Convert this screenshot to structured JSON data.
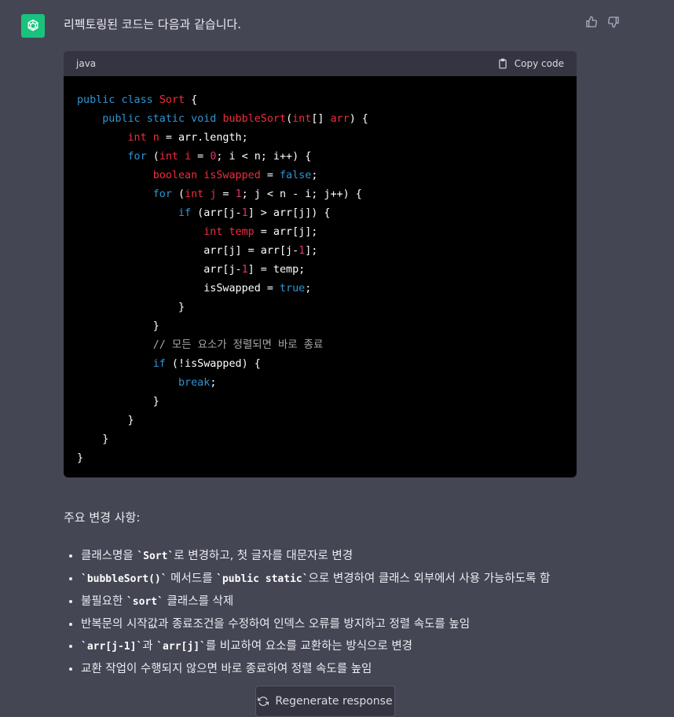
{
  "message": {
    "intro": "리펙토링된 코드는 다음과 같습니다.",
    "avatar_icon": "openai-logo-icon"
  },
  "codeblock": {
    "language": "java",
    "copy_label": "Copy code",
    "lines": [
      "public class Sort {",
      "    public static void bubbleSort(int[] arr) {",
      "        int n = arr.length;",
      "        for (int i = 0; i < n; i++) {",
      "            boolean isSwapped = false;",
      "            for (int j = 1; j < n - i; j++) {",
      "                if (arr[j-1] > arr[j]) {",
      "                    int temp = arr[j];",
      "                    arr[j] = arr[j-1];",
      "                    arr[j-1] = temp;",
      "                    isSwapped = true;",
      "                }",
      "            }",
      "            // 모든 요소가 정렬되면 바로 종료",
      "            if (!isSwapped) {",
      "                break;",
      "            }",
      "        }",
      "    }",
      "}"
    ]
  },
  "summary": {
    "title": "주요 변경 사항:",
    "items": [
      {
        "pre": "클래스명을 ",
        "code": "`Sort`",
        "mid": "로 변경하고, 첫 글자를 대문자로 변경",
        "code2": "",
        "post": ""
      },
      {
        "pre": "",
        "code": "`bubbleSort()`",
        "mid": " 메서드를 ",
        "code2": "`public static`",
        "post": "으로 변경하여 클래스 외부에서 사용 가능하도록 함"
      },
      {
        "pre": "불필요한 ",
        "code": "`sort`",
        "mid": " 클래스를 삭제",
        "code2": "",
        "post": ""
      },
      {
        "pre": "반복문의 시작값과 종료조건을 수정하여 인덱스 오류를 방지하고 정렬 속도를 높임",
        "code": "",
        "mid": "",
        "code2": "",
        "post": ""
      },
      {
        "pre": "",
        "code": "`arr[j-1]`",
        "mid": "과 ",
        "code2": "`arr[j]`",
        "post": "를 비교하여 요소를 교환하는 방식으로 변경"
      },
      {
        "pre": "교환 작업이 수행되지 않으면 바로 종료하여 정렬 속도를 높임",
        "code": "",
        "mid": "",
        "code2": "",
        "post": ""
      }
    ]
  },
  "regenerate_label": "Regenerate response",
  "colors": {
    "background": "#444654",
    "code_bg": "#000000",
    "keyword": "#2e95d3",
    "identifier": "#f22c3d",
    "brand": "#19c37d"
  }
}
